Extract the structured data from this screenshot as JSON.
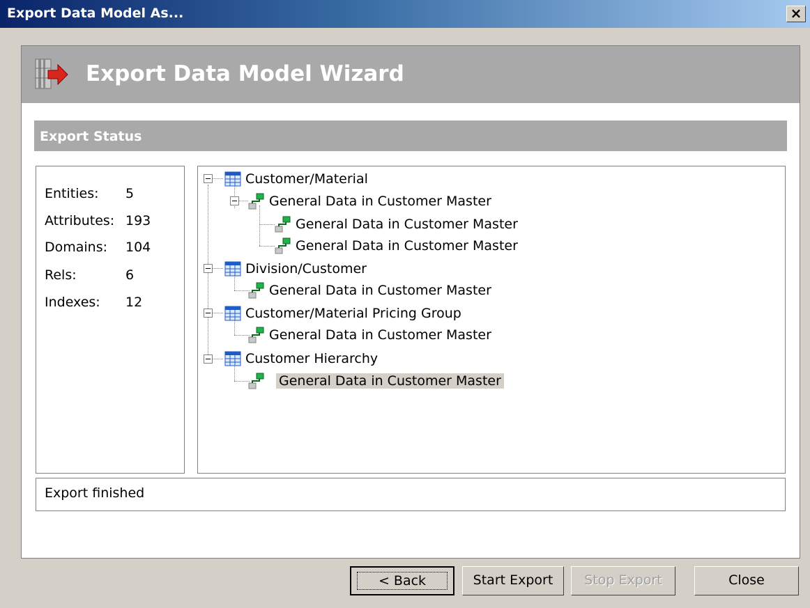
{
  "window": {
    "title": "Export Data Model As...",
    "close_glyph": "×"
  },
  "banner": {
    "title": "Export Data Model Wizard",
    "icon": "export-database-icon"
  },
  "section": {
    "title": "Export Status"
  },
  "stats": [
    {
      "label": "Entities:",
      "value": "5"
    },
    {
      "label": "Attributes:",
      "value": "193"
    },
    {
      "label": "Domains:",
      "value": "104"
    },
    {
      "label": "Rels:",
      "value": "6"
    },
    {
      "label": "Indexes:",
      "value": "12"
    }
  ],
  "tree": {
    "nodes": [
      {
        "label": "Customer/Material",
        "type": "entity"
      },
      {
        "label": "General Data in Customer Master",
        "type": "relationship"
      },
      {
        "label": "General Data in Customer Master",
        "type": "relationship"
      },
      {
        "label": "General Data in Customer Master",
        "type": "relationship"
      },
      {
        "label": "Division/Customer",
        "type": "entity"
      },
      {
        "label": "General Data in Customer Master",
        "type": "relationship"
      },
      {
        "label": "Customer/Material Pricing Group",
        "type": "entity"
      },
      {
        "label": "General Data in Customer Master",
        "type": "relationship"
      },
      {
        "label": "Customer Hierarchy",
        "type": "entity"
      },
      {
        "label": "General Data in Customer Master",
        "type": "relationship",
        "selected": true
      }
    ]
  },
  "status": {
    "message": "Export finished"
  },
  "buttons": {
    "back": "< Back",
    "start_export": "Start Export",
    "stop_export": "Stop Export",
    "close": "Close"
  },
  "colors": {
    "banner": "#a9a9a9",
    "dialog": "#d4d0c8",
    "titlebar_start": "#0a246a",
    "titlebar_end": "#a6caf0"
  }
}
